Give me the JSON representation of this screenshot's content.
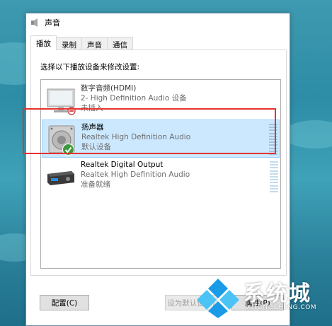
{
  "window": {
    "title": "声音"
  },
  "tabs": [
    {
      "label": "播放",
      "active": true
    },
    {
      "label": "录制",
      "active": false
    },
    {
      "label": "声音",
      "active": false
    },
    {
      "label": "通信",
      "active": false
    }
  ],
  "panel": {
    "instruction": "选择以下播放设备来修改设置:"
  },
  "devices": [
    {
      "name": "数字音频(HDMI)",
      "line2": "2- High Definition Audio 设备",
      "status": "未插入",
      "icon": "monitor-icon",
      "state": "disabled"
    },
    {
      "name": "扬声器",
      "line2": "Realtek High Definition Audio",
      "status": "默认设备",
      "icon": "speaker-icon",
      "state": "selected-default"
    },
    {
      "name": "Realtek Digital Output",
      "line2": "Realtek High Definition Audio",
      "status": "准备就绪",
      "icon": "receiver-icon",
      "state": "ready"
    }
  ],
  "buttons": {
    "configure": "配置(C)",
    "set_default": "设为默认值(S)",
    "properties": "属性(P)"
  },
  "watermark": {
    "brand": "系统城",
    "site": "XITONGCHENG.COM"
  },
  "colors": {
    "selection": "#cce8ff",
    "highlight_box": "#e5322d",
    "default_check": "#3c9a3c"
  }
}
